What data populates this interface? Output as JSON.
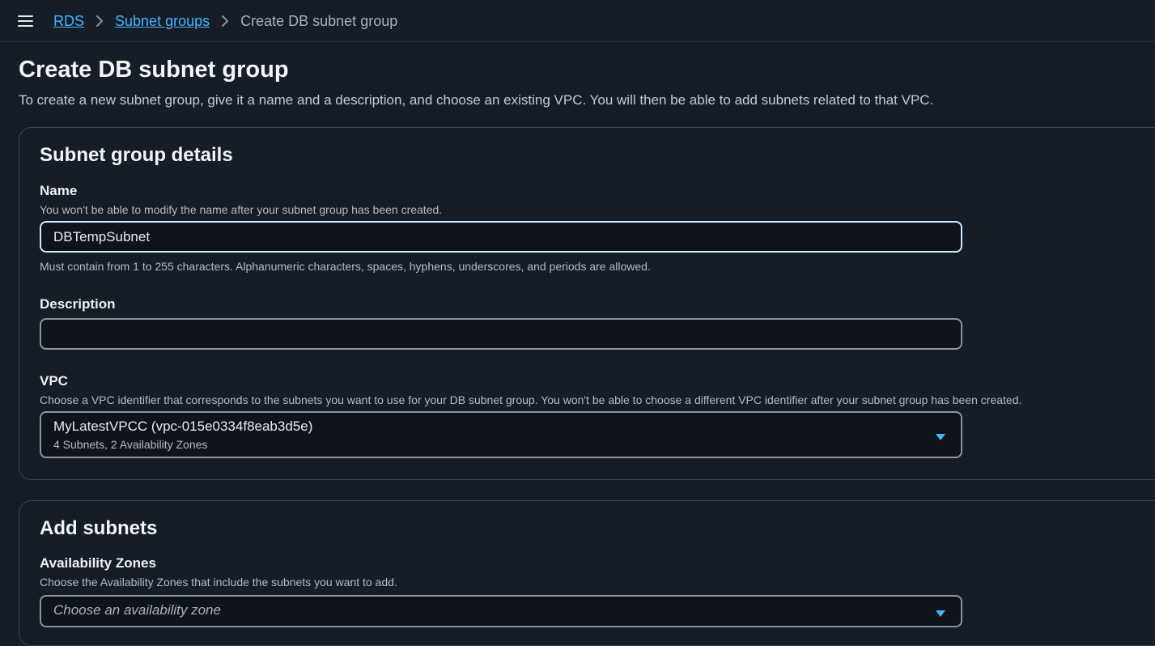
{
  "breadcrumb": {
    "items": [
      "RDS",
      "Subnet groups"
    ],
    "current": "Create DB subnet group"
  },
  "page": {
    "title": "Create DB subnet group",
    "description": "To create a new subnet group, give it a name and a description, and choose an existing VPC. You will then be able to add subnets related to that VPC."
  },
  "details": {
    "title": "Subnet group details",
    "name": {
      "label": "Name",
      "hint": "You won't be able to modify the name after your subnet group has been created.",
      "value": "DBTempSubnet",
      "constraint": "Must contain from 1 to 255 characters. Alphanumeric characters, spaces, hyphens, underscores, and periods are allowed."
    },
    "description": {
      "label": "Description",
      "value": ""
    },
    "vpc": {
      "label": "VPC",
      "hint": "Choose a VPC identifier that corresponds to the subnets you want to use for your DB subnet group. You won't be able to choose a different VPC identifier after your subnet group has been created.",
      "selected": "MyLatestVPCC (vpc-015e0334f8eab3d5e)",
      "selected_sub": "4 Subnets, 2 Availability Zones"
    }
  },
  "add_subnets": {
    "title": "Add subnets",
    "az": {
      "label": "Availability Zones",
      "hint": "Choose the Availability Zones that include the subnets you want to add.",
      "placeholder": "Choose an availability zone"
    }
  },
  "colors": {
    "background": "#161d26",
    "link": "#42b4ff",
    "border": "#3b4452",
    "input_border": "#8c95a1",
    "focus_border": "#cfe9ff",
    "caret": "#42b4ff"
  },
  "icons": {
    "menu": "menu-icon",
    "breadcrumb_separator": "chevron-right-icon",
    "dropdown": "caret-down-icon"
  }
}
